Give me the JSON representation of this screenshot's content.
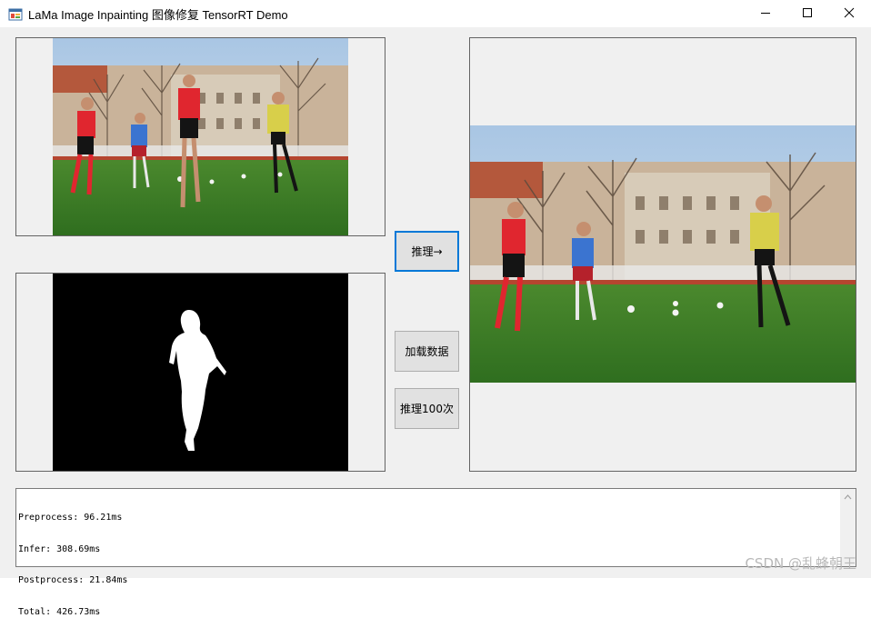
{
  "window": {
    "title": "LaMa Image Inpainting 图像修复 TensorRT Demo",
    "icon": "app-window-icon",
    "controls": [
      "minimize-icon",
      "maximize-icon",
      "close-icon"
    ]
  },
  "images": {
    "source": {
      "name": "source-image",
      "scene": "football players on grass field"
    },
    "mask": {
      "name": "mask-image",
      "scene": "white player silhouette on black"
    },
    "result": {
      "name": "result-image",
      "scene": "inpainted football scene"
    }
  },
  "buttons": {
    "infer": "推理→",
    "load": "加载数据",
    "infer100": "推理100次"
  },
  "log": {
    "lines": [
      "Preprocess: 96.21ms",
      "Infer: 308.69ms",
      "Postprocess: 21.84ms",
      "Total: 426.73ms"
    ]
  },
  "watermark": "CSDN @乱蜂朝王",
  "colors": {
    "focus_border": "#0078d7",
    "button_bg": "#e1e1e1",
    "form_bg": "#f0f0f0"
  }
}
